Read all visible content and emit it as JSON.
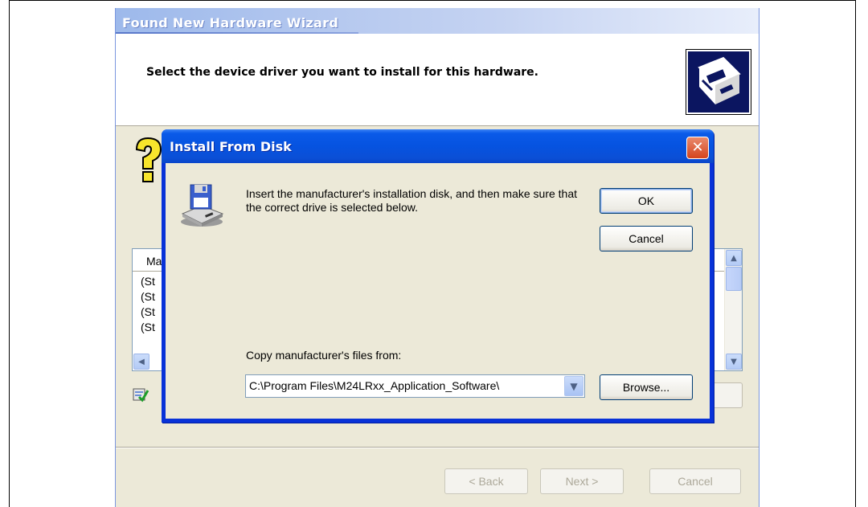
{
  "wizard": {
    "title": "Found New Hardware Wizard",
    "header": "Select the device driver you want to install for this hardware.",
    "list_header": "Ma",
    "list_rows": [
      "(St",
      "(St",
      "(St",
      "(St"
    ],
    "back_label": "< Back",
    "next_label": "Next >",
    "cancel_label": "Cancel"
  },
  "dialog": {
    "title": "Install From Disk",
    "close_glyph": "✕",
    "instruction": "Insert the manufacturer's installation disk, and then make sure that the correct drive is selected below.",
    "ok_label": "OK",
    "cancel_label": "Cancel",
    "copy_label": "Copy manufacturer's files from:",
    "path_value": "C:\\Program Files\\M24LRxx_Application_Software\\",
    "browse_label": "Browse..."
  },
  "icons": {
    "wizard_header": "hardware-icon",
    "help": "question-icon",
    "disk": "floppy-disk-icon",
    "signed": "signed-driver-icon",
    "combo": "chevron-down-icon"
  },
  "colors": {
    "dialog_frame": "#0832d8",
    "dialog_titlebar": "#0653e0",
    "close_button": "#d5441d",
    "window_face": "#ece9d8",
    "wizard_titlebar": "#9db9eb"
  }
}
